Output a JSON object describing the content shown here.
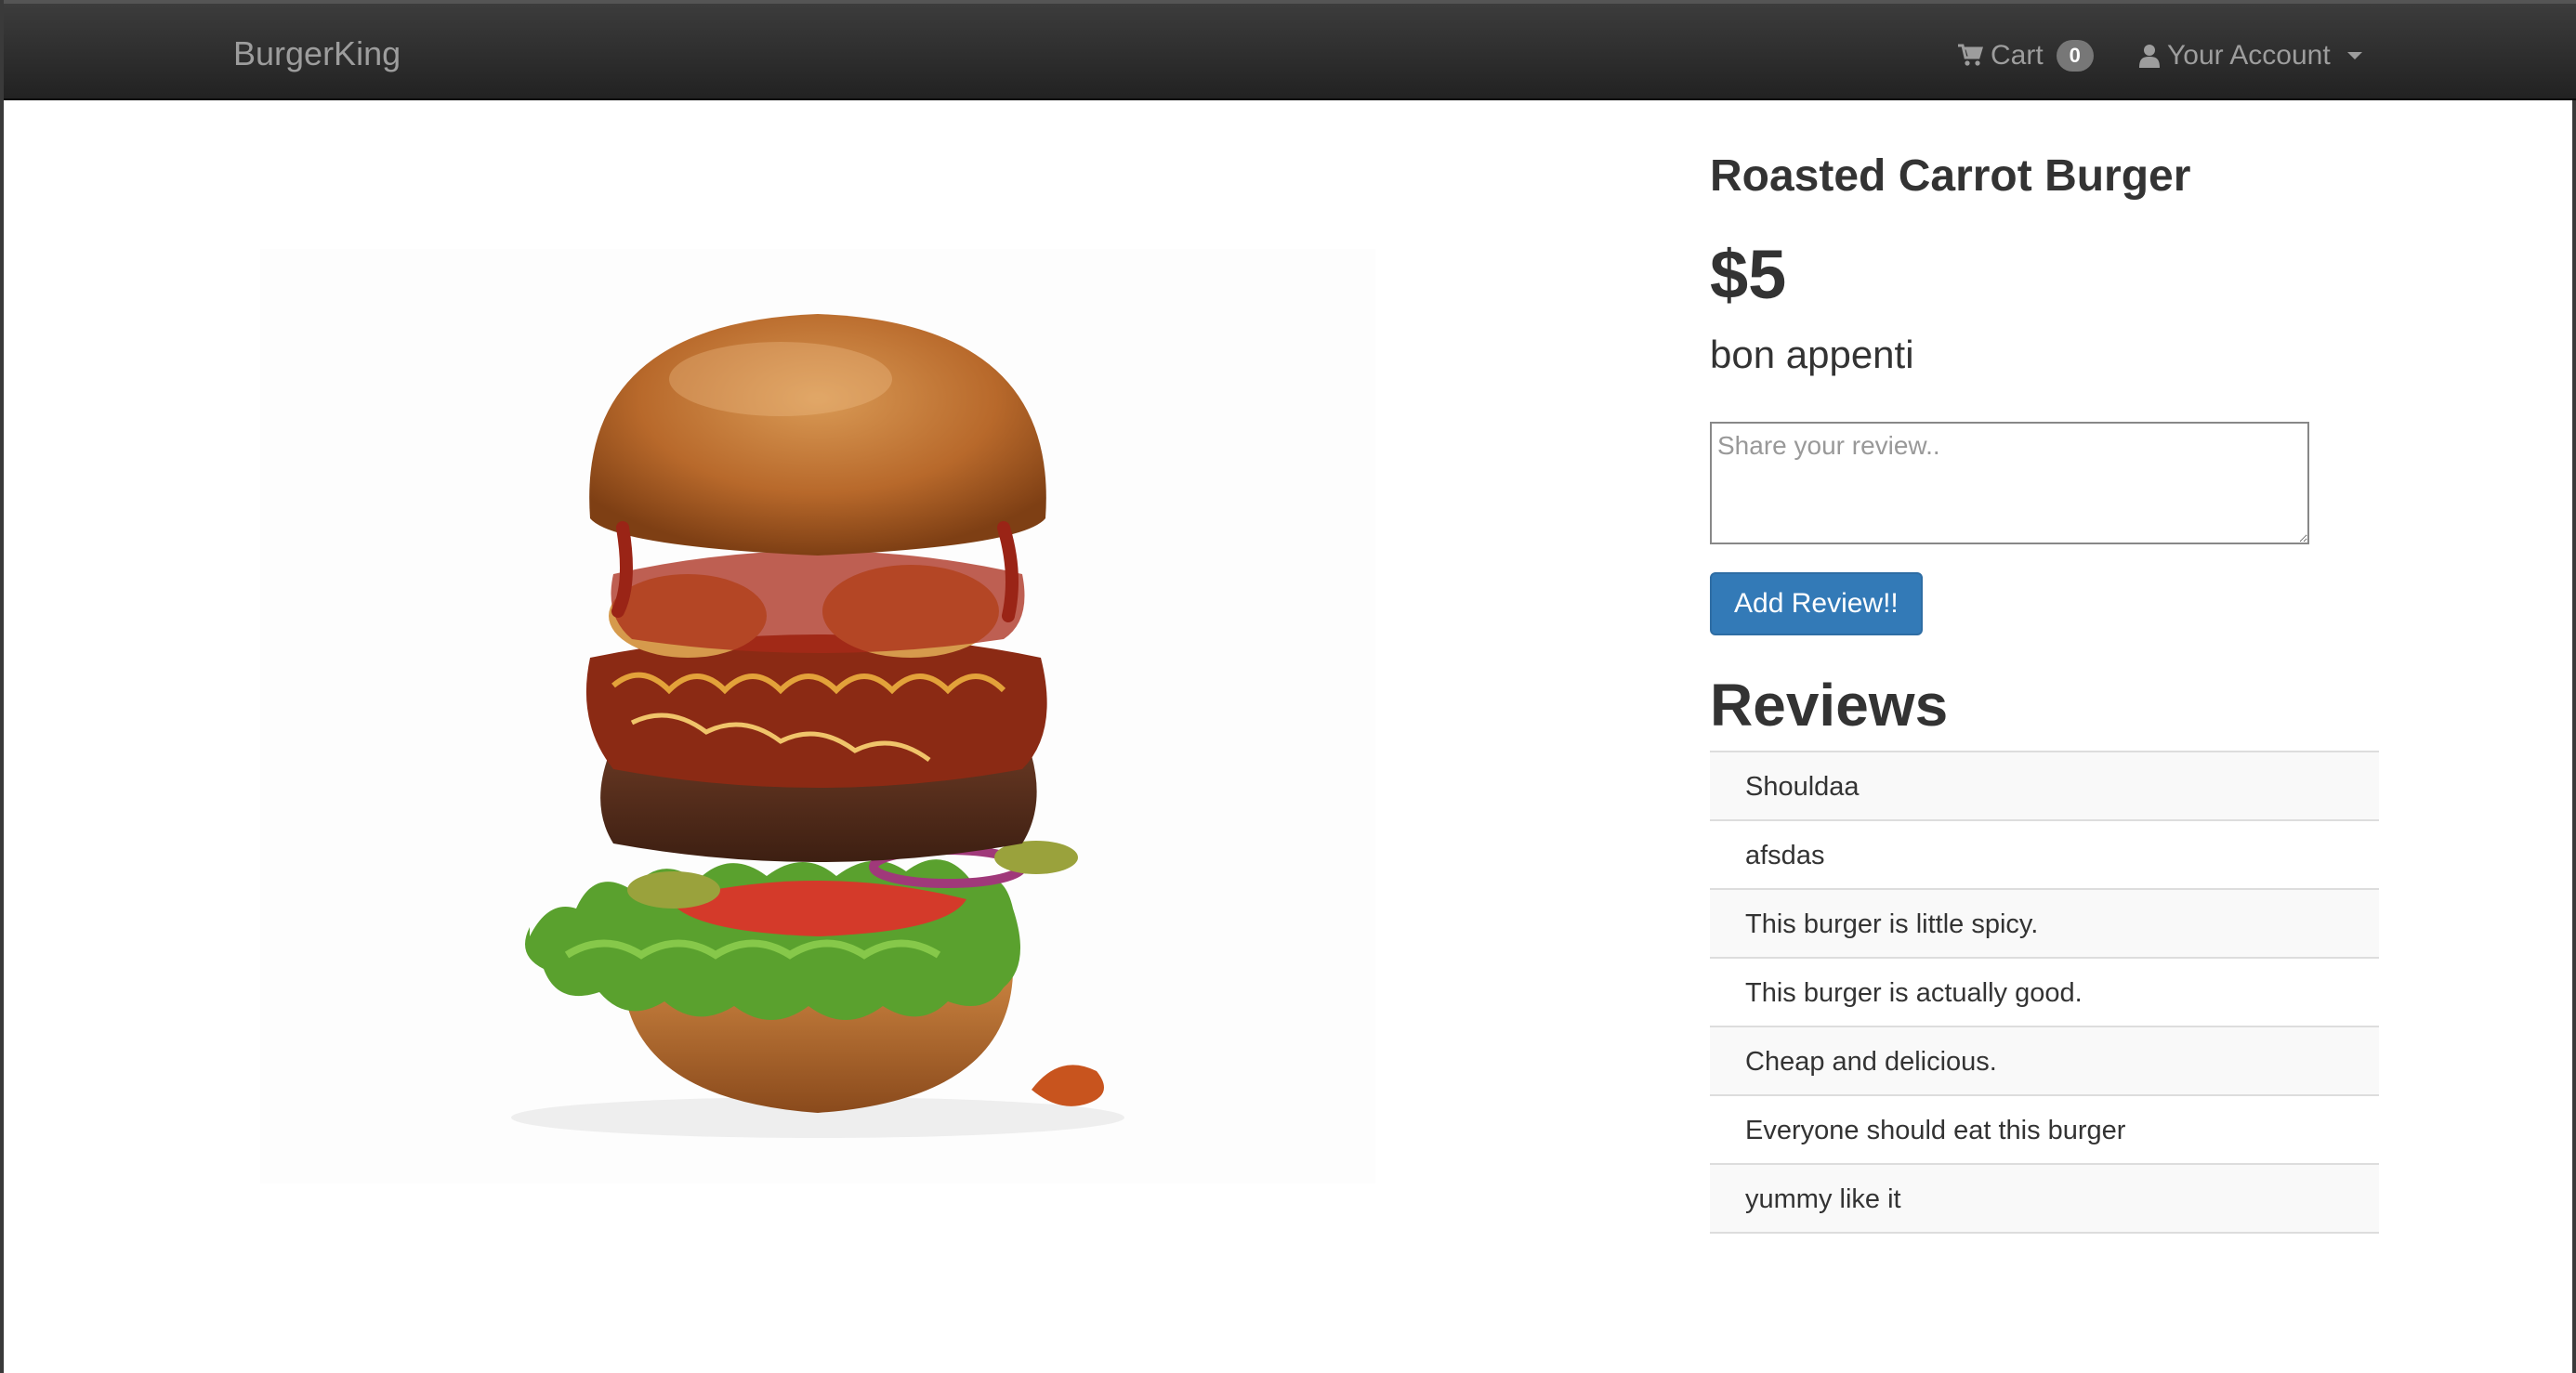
{
  "navbar": {
    "brand": "BurgerKing",
    "cart_label": "Cart",
    "cart_count": "0",
    "account_label": "Your Account"
  },
  "product": {
    "title": "Roasted Carrot Burger",
    "price": "$5",
    "tagline": "bon appenti",
    "image_alt": "burger-photo"
  },
  "review_form": {
    "placeholder": "Share your review..",
    "value": "",
    "button_label": "Add Review!!"
  },
  "reviews": {
    "heading": "Reviews",
    "items": [
      "Shouldaa",
      "afsdas",
      "This burger is little spicy.",
      "This burger is actually good.",
      "Cheap and delicious.",
      "Everyone should eat this burger",
      "yummy like it"
    ]
  },
  "colors": {
    "navbar_bg": "#222222",
    "nav_text": "#9d9d9d",
    "badge_bg": "#777777",
    "button_bg": "#337ab7",
    "stripe_bg": "#f9f9f9"
  }
}
